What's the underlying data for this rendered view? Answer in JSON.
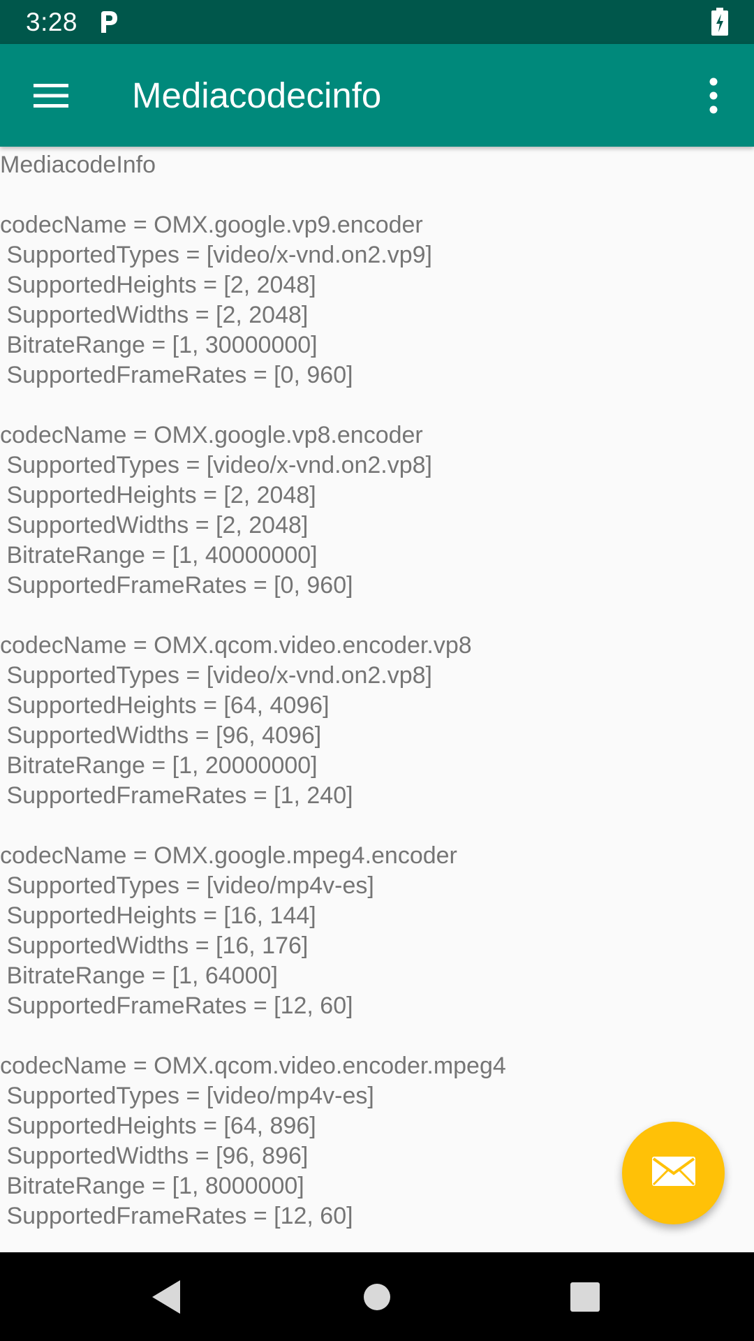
{
  "status_bar": {
    "time": "3:28",
    "icons": [
      "parking-icon",
      "battery-charging-icon"
    ]
  },
  "app_bar": {
    "title": "Mediacodecinfo",
    "left_icon": "hamburger-menu-icon",
    "right_icon": "overflow-menu-icon"
  },
  "content": {
    "header": "MediacodeInfo",
    "codecs": [
      {
        "codec_name": "codecName = OMX.google.vp9.encoder",
        "supported_types": " SupportedTypes = [video/x-vnd.on2.vp9]",
        "supported_heights": " SupportedHeights = [2, 2048]",
        "supported_widths": " SupportedWidths = [2, 2048]",
        "bitrate_range": " BitrateRange = [1, 30000000]",
        "supported_frame_rates": " SupportedFrameRates = [0, 960]"
      },
      {
        "codec_name": "codecName = OMX.google.vp8.encoder",
        "supported_types": " SupportedTypes = [video/x-vnd.on2.vp8]",
        "supported_heights": " SupportedHeights = [2, 2048]",
        "supported_widths": " SupportedWidths = [2, 2048]",
        "bitrate_range": " BitrateRange = [1, 40000000]",
        "supported_frame_rates": " SupportedFrameRates = [0, 960]"
      },
      {
        "codec_name": "codecName = OMX.qcom.video.encoder.vp8",
        "supported_types": " SupportedTypes = [video/x-vnd.on2.vp8]",
        "supported_heights": " SupportedHeights = [64, 4096]",
        "supported_widths": " SupportedWidths = [96, 4096]",
        "bitrate_range": " BitrateRange = [1, 20000000]",
        "supported_frame_rates": " SupportedFrameRates = [1, 240]"
      },
      {
        "codec_name": "codecName = OMX.google.mpeg4.encoder",
        "supported_types": " SupportedTypes = [video/mp4v-es]",
        "supported_heights": " SupportedHeights = [16, 144]",
        "supported_widths": " SupportedWidths = [16, 176]",
        "bitrate_range": " BitrateRange = [1, 64000]",
        "supported_frame_rates": " SupportedFrameRates = [12, 60]"
      },
      {
        "codec_name": "codecName = OMX.qcom.video.encoder.mpeg4",
        "supported_types": " SupportedTypes = [video/mp4v-es]",
        "supported_heights": " SupportedHeights = [64, 896]",
        "supported_widths": " SupportedWidths = [96, 896]",
        "bitrate_range": " BitrateRange = [1, 8000000]",
        "supported_frame_rates": " SupportedFrameRates = [12, 60]"
      }
    ]
  },
  "fab": {
    "icon": "mail-icon",
    "color": "#ffc107"
  },
  "nav_bar": {
    "icons": [
      "back-icon",
      "home-icon",
      "recents-icon"
    ]
  },
  "colors": {
    "status_bar": "#00574b",
    "app_bar": "#00897b",
    "text": "#757575",
    "background": "#fafafa"
  }
}
